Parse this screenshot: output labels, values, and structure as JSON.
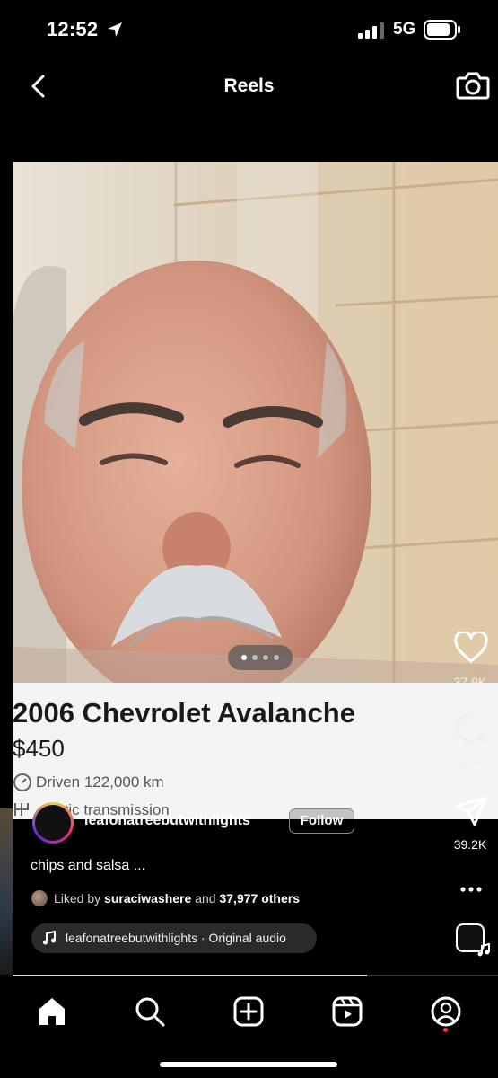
{
  "status_bar": {
    "time": "12:52",
    "network": "5G",
    "icons": [
      "location-arrow-icon",
      "signal-bars-icon",
      "battery-icon"
    ]
  },
  "header": {
    "title": "Reels",
    "back_icon": "chevron-left-icon",
    "camera_icon": "camera-icon"
  },
  "reel": {
    "listing": {
      "title": "2006 Chevrolet Avalanche",
      "price": "$450",
      "mileage": "Driven 122,000 km",
      "transmission_partial": "matic transmission"
    },
    "carousel": {
      "dots": 4,
      "active_index": 0
    },
    "progress_fraction": 0.73
  },
  "author": {
    "username": "leafonatreebutwithlights",
    "follow_label": "Follow"
  },
  "caption": "chips and salsa ...",
  "likes": {
    "prefix": "Liked by ",
    "user": "suraciwashere",
    "suffix": " and ",
    "others": "37,977 others"
  },
  "audio": {
    "label": "leafonatreebutwithlights · Original audio"
  },
  "actions": {
    "like_count": "37.9K",
    "comment_count": "134",
    "share_count": "39.2K",
    "more_label": "•••"
  },
  "bottom_nav": {
    "items": [
      "home-icon",
      "search-icon",
      "create-icon",
      "reels-icon",
      "profile-icon"
    ],
    "notification_color": "#ff3040"
  }
}
